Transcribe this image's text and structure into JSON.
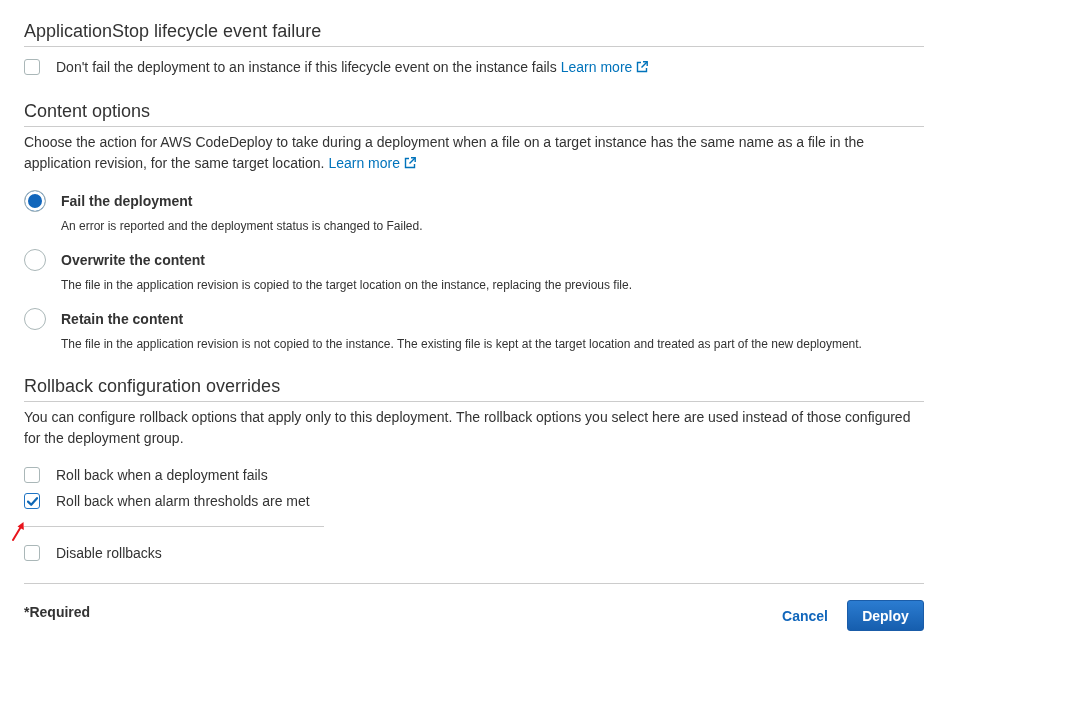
{
  "application_stop": {
    "title": "ApplicationStop lifecycle event failure",
    "option": {
      "label": "Don't fail the deployment to an instance if this lifecycle event on the instance fails",
      "link": "Learn more",
      "checked": false
    }
  },
  "content_options": {
    "title": "Content options",
    "description": "Choose the action for AWS CodeDeploy to take during a deployment when a file on a target instance has the same name as a file in the application revision, for the same target location.",
    "link": "Learn more",
    "options": [
      {
        "label": "Fail the deployment",
        "description": "An error is reported and the deployment status is changed to Failed.",
        "selected": true
      },
      {
        "label": "Overwrite the content",
        "description": "The file in the application revision is copied to the target location on the instance, replacing the previous file.",
        "selected": false
      },
      {
        "label": "Retain the content",
        "description": "The file in the application revision is not copied to the instance. The existing file is kept at the target location and treated as part of the new deployment.",
        "selected": false
      }
    ]
  },
  "rollback": {
    "title": "Rollback configuration overrides",
    "description": "You can configure rollback options that apply only to this deployment. The rollback options you select here are used instead of those configured for the deployment group.",
    "options": [
      {
        "label": "Roll back when a deployment fails",
        "checked": false
      },
      {
        "label": "Roll back when alarm thresholds are met",
        "checked": true
      }
    ],
    "disable": {
      "label": "Disable rollbacks",
      "checked": false
    }
  },
  "footer": {
    "required": "*Required",
    "buttons": [
      {
        "kind": "link",
        "label": "Cancel"
      },
      {
        "kind": "primary",
        "label": "Deploy"
      }
    ]
  }
}
